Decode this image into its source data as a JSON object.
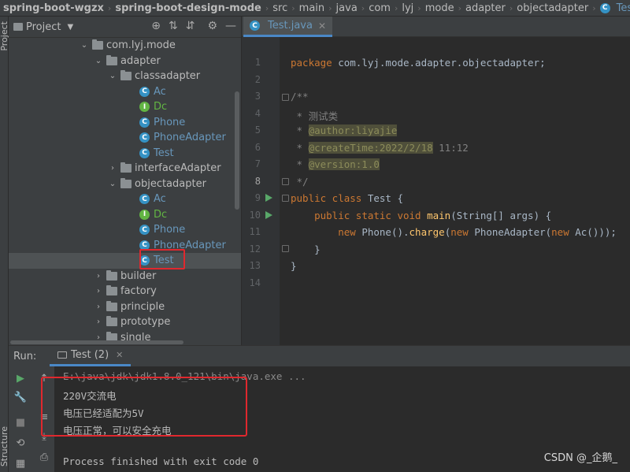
{
  "breadcrumb": {
    "items": [
      "spring-boot-wgzx",
      "spring-boot-design-mode",
      "src",
      "main",
      "java",
      "com",
      "lyj",
      "mode",
      "adapter",
      "objectadapter"
    ],
    "last": "Test"
  },
  "left_stripe": {
    "project_label": "Project",
    "structure_label": "Structure"
  },
  "project_panel": {
    "title": "Project",
    "tools": [
      "target-icon",
      "collapse-all-icon",
      "expand-all-icon",
      "gear-icon",
      "minimize-icon"
    ]
  },
  "tree": {
    "rows": [
      {
        "label": "com.lyj.mode",
        "kind": "package",
        "expanded": true
      },
      {
        "label": "adapter",
        "kind": "package",
        "expanded": true
      },
      {
        "label": "classadapter",
        "kind": "package",
        "expanded": true
      },
      {
        "label": "Ac",
        "kind": "class",
        "icon": "C"
      },
      {
        "label": "Dc",
        "kind": "interface",
        "icon": "I"
      },
      {
        "label": "Phone",
        "kind": "class",
        "icon": "C"
      },
      {
        "label": "PhoneAdapter",
        "kind": "class",
        "icon": "C"
      },
      {
        "label": "Test",
        "kind": "class",
        "icon": "C"
      },
      {
        "label": "interfaceAdapter",
        "kind": "package",
        "expanded": false
      },
      {
        "label": "objectadapter",
        "kind": "package",
        "expanded": true
      },
      {
        "label": "Ac",
        "kind": "class",
        "icon": "C"
      },
      {
        "label": "Dc",
        "kind": "interface",
        "icon": "I"
      },
      {
        "label": "Phone",
        "kind": "class",
        "icon": "C"
      },
      {
        "label": "PhoneAdapter",
        "kind": "class",
        "icon": "C"
      },
      {
        "label": "Test",
        "kind": "class",
        "icon": "C",
        "selected": true
      },
      {
        "label": "builder",
        "kind": "package",
        "expanded": false
      },
      {
        "label": "factory",
        "kind": "package",
        "expanded": false
      },
      {
        "label": "principle",
        "kind": "package",
        "expanded": false
      },
      {
        "label": "prototype",
        "kind": "package",
        "expanded": false
      },
      {
        "label": "single",
        "kind": "package",
        "expanded": false
      }
    ]
  },
  "editor": {
    "tab_label": "Test.java",
    "line_numbers": [
      "1",
      "2",
      "3",
      "4",
      "5",
      "6",
      "7",
      "8",
      "9",
      "10",
      "11",
      "12",
      "13",
      "14"
    ],
    "code": {
      "l1_kw": "package",
      "l1_rest": " com.lyj.mode.adapter.objectadapter;",
      "l3": "/**",
      "l4": " * 测试类",
      "l5_prefix": " * ",
      "l5_tag": "@author:liyajie",
      "l6_prefix": " * ",
      "l6_tag": "@createTime:2022/2/18",
      "l6_rest": " 11:12",
      "l7_prefix": " * ",
      "l7_tag": "@version:1.0",
      "l8": " */",
      "l9_kw": "public class",
      "l9_rest": " Test {",
      "l10_indent": "    ",
      "l10_kw": "public static void",
      "l10_sp": " ",
      "l10_fn": "main",
      "l10_rest": "(String[] args) {",
      "l11_indent": "        ",
      "l11_kw1": "new",
      "l11_a": " Phone().",
      "l11_fn": "charge",
      "l11_b": "(",
      "l11_kw2": "new",
      "l11_c": " PhoneAdapter(",
      "l11_kw3": "new",
      "l11_d": " Ac()));",
      "l12": "    }",
      "l13": "}"
    }
  },
  "run_panel": {
    "label": "Run:",
    "tab_label": "Test (2)",
    "console": {
      "command": "E:\\java\\jdk\\jdk1.8.0_121\\bin\\java.exe ...",
      "out1": "220V交流电",
      "out2": "电压已经适配为5V",
      "out3": "电压正常，可以安全充电",
      "finish": "Process finished with exit code 0"
    }
  },
  "watermark": "CSDN @_企鹅_",
  "colors": {
    "selection": "#4b6eaf",
    "highlight_box": "#e0282e",
    "keyword": "#cc7832",
    "method": "#ffc66d",
    "class_icon": "#3592c4",
    "interface_icon": "#62b543"
  }
}
